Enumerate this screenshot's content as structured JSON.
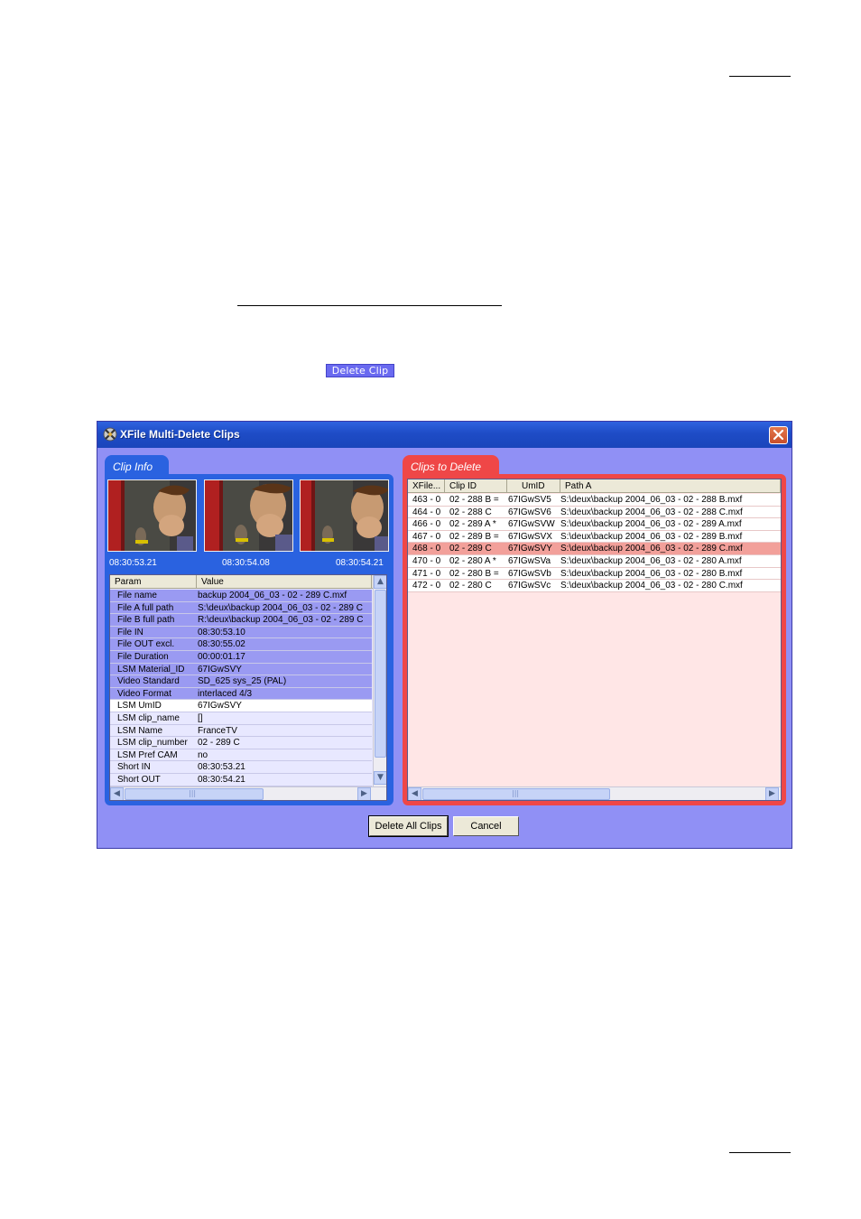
{
  "document": {
    "inline_button_label": "Delete Clip"
  },
  "window": {
    "title": "XFile Multi-Delete Clips",
    "close_label": "✕"
  },
  "clip_info": {
    "tab_label": "Clip Info",
    "timecodes": [
      "08:30:53.21",
      "08:30:54.08",
      "08:30:54.21"
    ],
    "columns": [
      "Param",
      "Value"
    ],
    "rows": [
      {
        "param": "File name",
        "value": "backup 2004_06_03 - 02 - 289 C.mxf",
        "selected": true
      },
      {
        "param": "File A full path",
        "value": "S:\\deux\\backup 2004_06_03 - 02 - 289 C",
        "selected": true
      },
      {
        "param": "File B full path",
        "value": "R:\\deux\\backup 2004_06_03 - 02 - 289 C",
        "selected": true
      },
      {
        "param": "File IN",
        "value": "08:30:53.10",
        "selected": true
      },
      {
        "param": "File OUT excl.",
        "value": "08:30:55.02",
        "selected": true
      },
      {
        "param": "File Duration",
        "value": "00:00:01.17",
        "selected": true
      },
      {
        "param": "LSM Material_ID",
        "value": "67IGwSVY",
        "selected": true
      },
      {
        "param": "Video Standard",
        "value": "SD_625 sys_25 (PAL)",
        "selected": true
      },
      {
        "param": "Video Format",
        "value": "interlaced 4/3",
        "selected": true
      },
      {
        "param": "LSM UmID",
        "value": "67IGwSVY",
        "selected": false
      },
      {
        "param": "LSM clip_name",
        "value": "[]",
        "selected": false
      },
      {
        "param": "LSM Name",
        "value": "FranceTV",
        "selected": false
      },
      {
        "param": "LSM clip_number",
        "value": "02 - 289 C",
        "selected": false
      },
      {
        "param": "LSM Pref CAM",
        "value": "no",
        "selected": false
      },
      {
        "param": "Short IN",
        "value": "08:30:53.21",
        "selected": false
      },
      {
        "param": "Short OUT",
        "value": "08:30:54.21",
        "selected": false
      }
    ]
  },
  "clips_to_delete": {
    "tab_label": "Clips to Delete",
    "columns": [
      "XFile...",
      "Clip ID",
      "UmID",
      "Path A"
    ],
    "rows": [
      {
        "xfile": "463 - 0",
        "clip_id": "02 - 288 B =",
        "umid": "67IGwSV5",
        "path": "S:\\deux\\backup 2004_06_03 - 02 - 288 B.mxf",
        "selected": false
      },
      {
        "xfile": "464 - 0",
        "clip_id": "02 - 288 C",
        "umid": "67IGwSV6",
        "path": "S:\\deux\\backup 2004_06_03 - 02 - 288 C.mxf",
        "selected": false
      },
      {
        "xfile": "466 - 0",
        "clip_id": "02 - 289 A *",
        "umid": "67IGwSVW",
        "path": "S:\\deux\\backup 2004_06_03 - 02 - 289 A.mxf",
        "selected": false
      },
      {
        "xfile": "467 - 0",
        "clip_id": "02 - 289 B =",
        "umid": "67IGwSVX",
        "path": "S:\\deux\\backup 2004_06_03 - 02 - 289 B.mxf",
        "selected": false
      },
      {
        "xfile": "468 - 0",
        "clip_id": "02 - 289 C",
        "umid": "67IGwSVY",
        "path": "S:\\deux\\backup 2004_06_03 - 02 - 289 C.mxf",
        "selected": true
      },
      {
        "xfile": "470 - 0",
        "clip_id": "02 - 280 A *",
        "umid": "67IGwSVa",
        "path": "S:\\deux\\backup 2004_06_03 - 02 - 280 A.mxf",
        "selected": false
      },
      {
        "xfile": "471 - 0",
        "clip_id": "02 - 280 B =",
        "umid": "67IGwSVb",
        "path": "S:\\deux\\backup 2004_06_03 - 02 - 280 B.mxf",
        "selected": false
      },
      {
        "xfile": "472 - 0",
        "clip_id": "02 - 280 C",
        "umid": "67IGwSVc",
        "path": "S:\\deux\\backup 2004_06_03 - 02 - 280 C.mxf",
        "selected": false
      }
    ]
  },
  "buttons": {
    "delete_all": "Delete All Clips",
    "cancel": "Cancel"
  },
  "scroll": {
    "left": "◀",
    "right": "▶",
    "up": "▲",
    "down": "▼",
    "grip": "|||"
  },
  "colors": {
    "window_bg": "#9090f5",
    "clip_info_accent": "#2a62e0",
    "clips_to_delete_accent": "#ef4747",
    "selected_param_row": "#9a9af2",
    "selected_clip_row": "#f2a09a"
  }
}
